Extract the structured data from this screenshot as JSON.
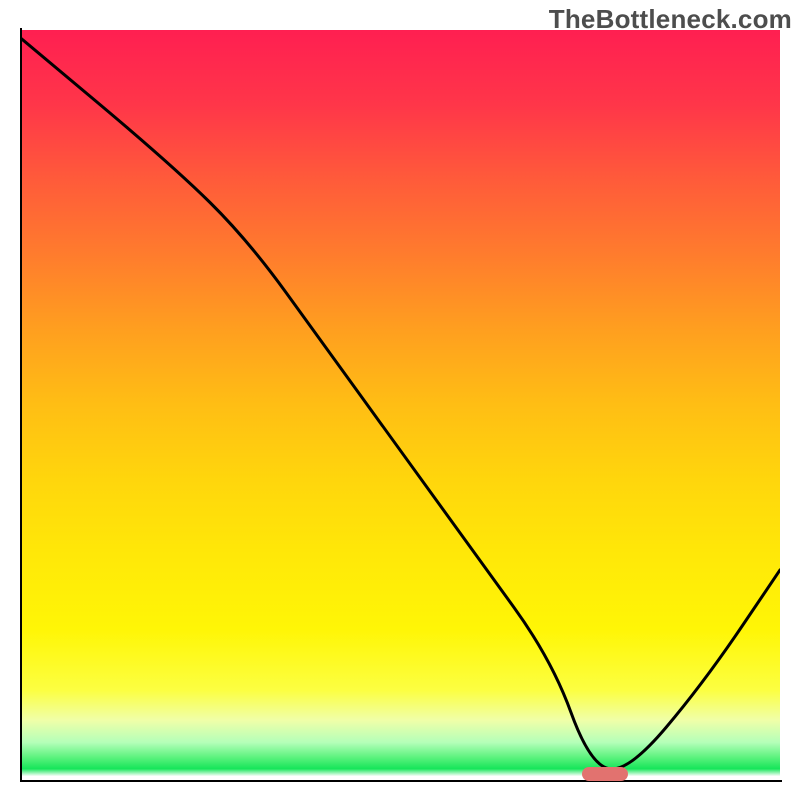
{
  "watermark": {
    "text": "TheBottleneck.com"
  },
  "chart_data": {
    "type": "line",
    "title": "",
    "xlabel": "",
    "ylabel": "",
    "xlim": [
      0,
      100
    ],
    "ylim": [
      0,
      100
    ],
    "grid": false,
    "legend": false,
    "series": [
      {
        "name": "curve",
        "x": [
          0,
          20,
          30,
          40,
          50,
          60,
          70,
          75,
          80,
          90,
          100
        ],
        "values": [
          99,
          82,
          72,
          58,
          44,
          30,
          16,
          2,
          1,
          13,
          28
        ]
      }
    ],
    "annotations": [
      {
        "type": "marker",
        "shape": "pill",
        "color": "#e2726f",
        "x_start": 74,
        "x_end": 80,
        "y": 1
      }
    ],
    "bands": [
      {
        "label": "red",
        "y_from": 75,
        "y_to": 100,
        "color": "#ff2a4e"
      },
      {
        "label": "orange",
        "y_from": 40,
        "y_to": 75,
        "color": "#ff8a28"
      },
      {
        "label": "yellow",
        "y_from": 10,
        "y_to": 40,
        "color": "#ffee10"
      },
      {
        "label": "green",
        "y_from": 1,
        "y_to": 10,
        "color": "#2fe862"
      }
    ]
  }
}
